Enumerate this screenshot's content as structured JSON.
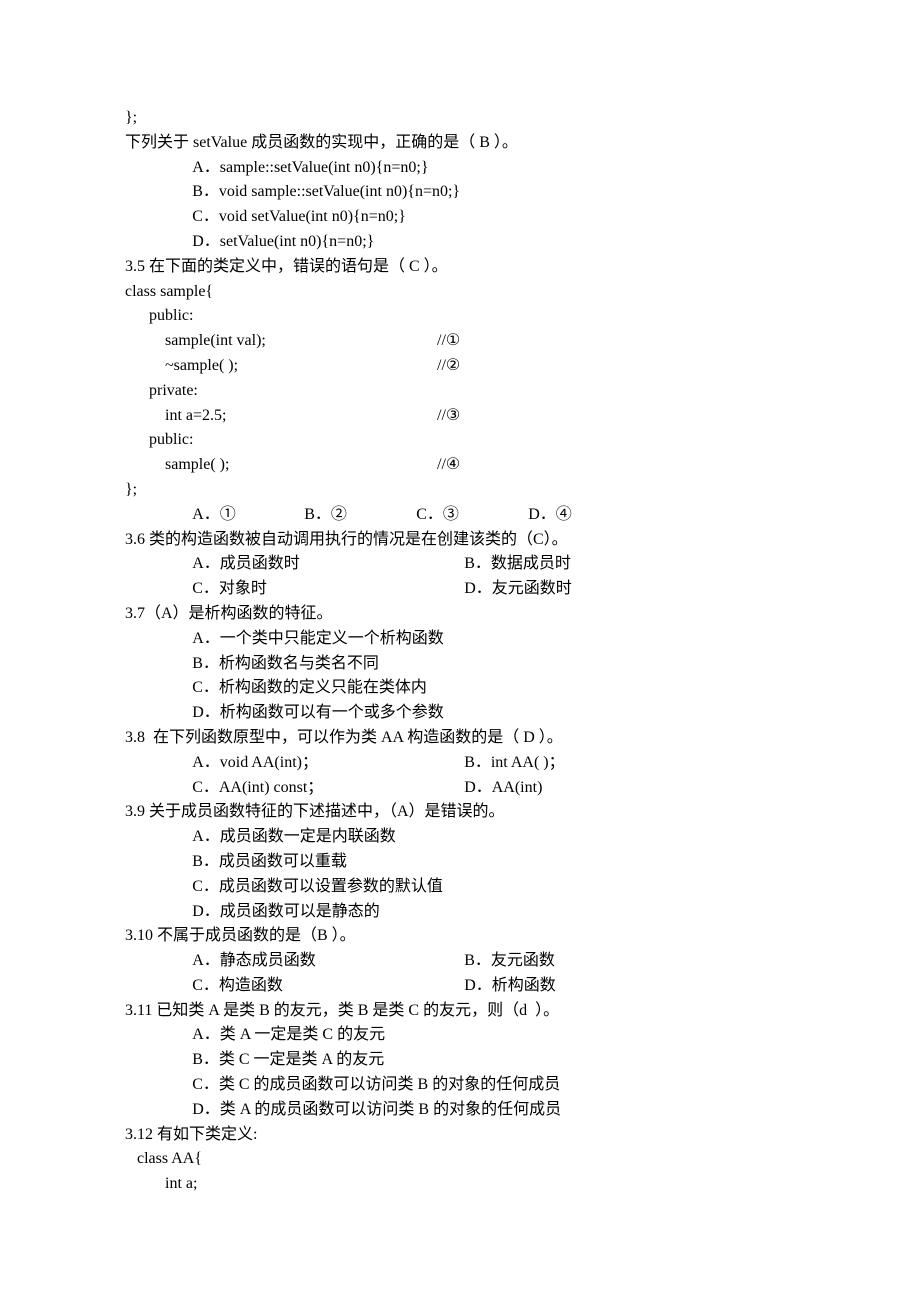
{
  "l0": "};",
  "l1": "下列关于 setValue 成员函数的实现中，正确的是（ B ）。",
  "opA_3_4": "A．sample::setValue(int n0){n=n0;}",
  "opB_3_4": "B．void sample::setValue(int n0){n=n0;}",
  "opC_3_4": "C．void setValue(int n0){n=n0;}",
  "opD_3_4": "D．setValue(int n0){n=n0;}",
  "q3_5": "3.5 在下面的类定义中，错误的语句是（ C ）。",
  "c1": "class sample{",
  "c2": "public:",
  "c3a": "sample(int val);",
  "c3b": "//①",
  "c4a": "~sample( );",
  "c4b": "//②",
  "c5": "private:",
  "c6a": "int a=2.5;",
  "c6b": "//③",
  "c7": "public:",
  "c8a": "sample( );",
  "c8b": "//④",
  "c9": "};",
  "q3_5opts": {
    "a": "A．①",
    "b": "B．②",
    "c": "C．③",
    "d": "D．④"
  },
  "q3_6": "3.6 类的构造函数被自动调用执行的情况是在创建该类的（C）。",
  "q3_6a": "A．成员函数时",
  "q3_6b": "B．数据成员时",
  "q3_6c": "C．对象时",
  "q3_6d": "D．友元函数时",
  "q3_7": "3.7（A）是析构函数的特征。",
  "q3_7a": "A．一个类中只能定义一个析构函数",
  "q3_7b": "B．析构函数名与类名不同",
  "q3_7c": "C．析构函数的定义只能在类体内",
  "q3_7d": "D．析构函数可以有一个或多个参数",
  "q3_8": "3.8  在下列函数原型中，可以作为类 AA 构造函数的是（ D ）。",
  "q3_8a": "A．void AA(int)；",
  "q3_8b": "B．int AA( )；",
  "q3_8c": "C．AA(int) const；",
  "q3_8d": "D．AA(int)",
  "q3_9": "3.9 关于成员函数特征的下述描述中，（A）是错误的。",
  "q3_9a": "A．成员函数一定是内联函数",
  "q3_9b": "B．成员函数可以重载",
  "q3_9c": "C．成员函数可以设置参数的默认值",
  "q3_9d": "D．成员函数可以是静态的",
  "q3_10": "3.10 不属于成员函数的是（B ）。",
  "q3_10a": "A．静态成员函数",
  "q3_10b": "B．友元函数",
  "q3_10c": "C．构造函数",
  "q3_10d": "D．析构函数",
  "q3_11": "3.11 已知类 A 是类 B 的友元，类 B 是类 C 的友元，则（d  ）。",
  "q3_11a": "A．类 A 一定是类 C 的友元",
  "q3_11b": "B．类 C 一定是类 A 的友元",
  "q3_11c": "C．类 C 的成员函数可以访问类 B 的对象的任何成员",
  "q3_11d": "D．类 A 的成员函数可以访问类 B 的对象的任何成员",
  "q3_12": "3.12 有如下类定义:",
  "q3_12c1": " class AA{",
  "q3_12c2": "int a;"
}
